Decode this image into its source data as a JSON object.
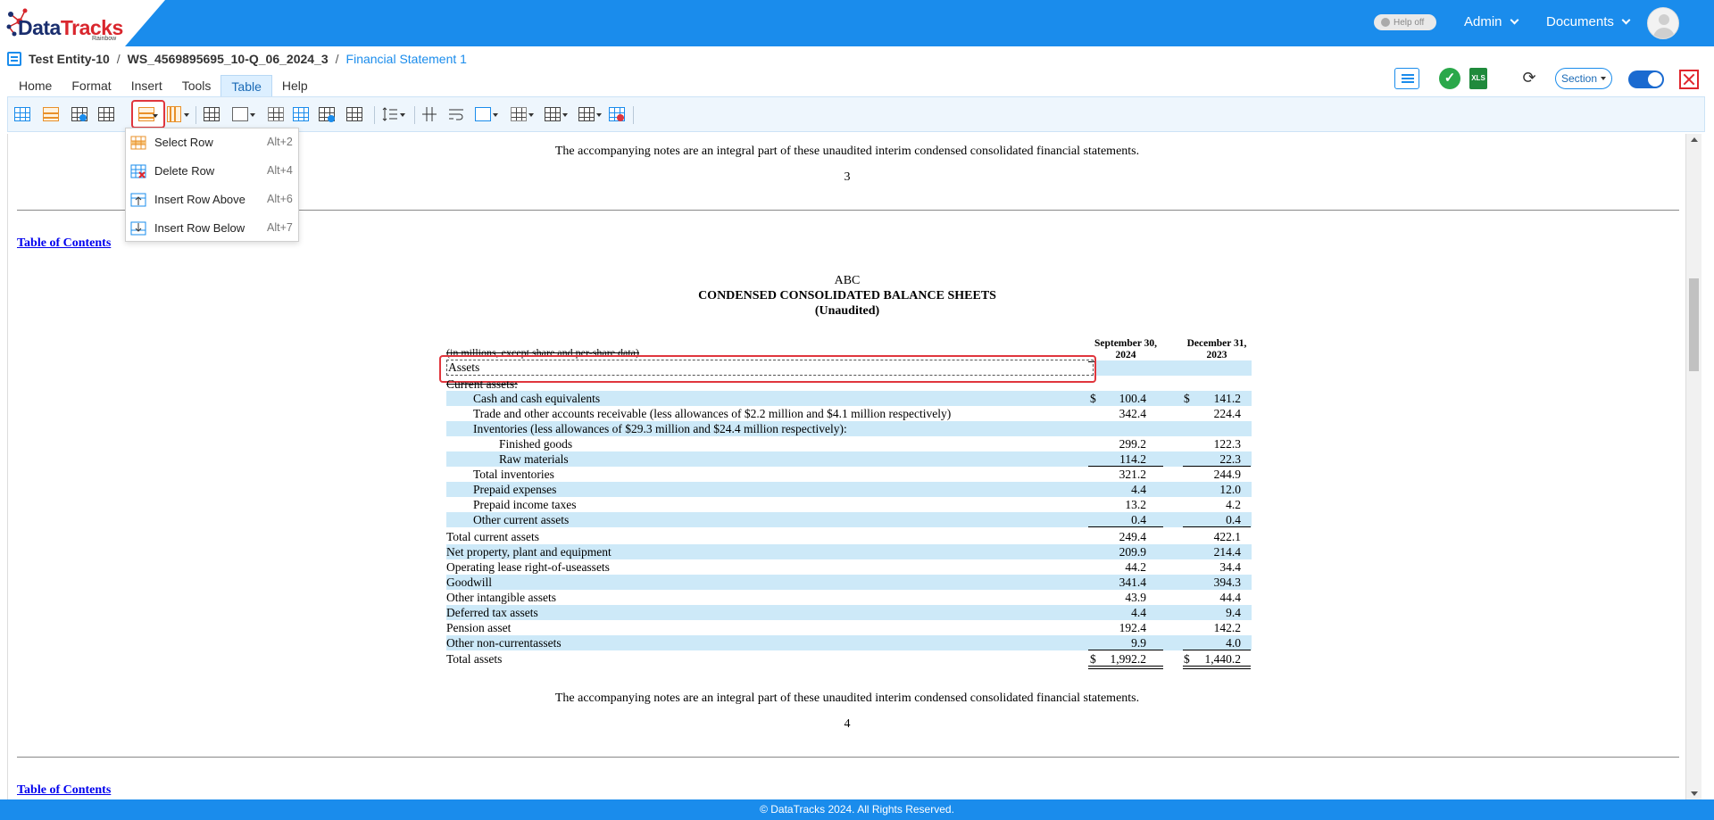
{
  "brand": {
    "logo_main": "Data",
    "logo_accent": "Tracks",
    "logo_sub": "Rainbow"
  },
  "topbar": {
    "help_toggle": "Help off",
    "admin_menu": "Admin",
    "documents_menu": "Documents"
  },
  "breadcrumb": {
    "entity": "Test Entity-10",
    "separator1": "/",
    "workspace": "WS_4569895695_10-Q_06_2024_3",
    "separator2": "/",
    "statement": "Financial Statement 1"
  },
  "tabs": [
    {
      "label": "Home"
    },
    {
      "label": "Format"
    },
    {
      "label": "Insert"
    },
    {
      "label": "Tools"
    },
    {
      "label": "Table",
      "active": true
    },
    {
      "label": "Help"
    }
  ],
  "right_tools": {
    "section_label": "Section",
    "xls_label": "XLS"
  },
  "row_menu": {
    "items": [
      {
        "label": "Select Row",
        "shortcut": "Alt+2"
      },
      {
        "label": "Delete Row",
        "shortcut": "Alt+4"
      },
      {
        "label": "Insert Row Above",
        "shortcut": "Alt+6"
      },
      {
        "label": "Insert Row Below",
        "shortcut": "Alt+7"
      }
    ]
  },
  "document": {
    "note_top": "The accompanying notes are an integral part of these unaudited interim condensed consolidated financial statements.",
    "page_num_top": "3",
    "toc_link": "Table of Contents",
    "company": "ABC",
    "statement_title": "CONDENSED CONSOLIDATED BALANCE SHEETS",
    "statement_subtitle": "(Unaudited)",
    "units_note": "(in millions, except share and per-share data)",
    "col1_header_l1": "September 30,",
    "col1_header_l2": "2024",
    "col2_header_l1": "December 31,",
    "col2_header_l2": "2023",
    "assets_label": "Assets",
    "current_assets_label": "Current assets:",
    "currency_symbol": "$",
    "rows": [
      {
        "label": "Cash and cash equivalents",
        "v1": "100.4",
        "v2": "141.2"
      },
      {
        "label": "Trade and other accounts receivable (less allowances of $2.2 million and $4.1 million respectively)",
        "v1": "342.4",
        "v2": "224.4"
      },
      {
        "label": "Inventories (less allowances of $29.3 million and $24.4 million respectively):",
        "v1": "",
        "v2": ""
      },
      {
        "label": "Finished goods",
        "v1": "299.2",
        "v2": "122.3"
      },
      {
        "label": "Raw materials",
        "v1": "114.2",
        "v2": "22.3"
      },
      {
        "label": "Total inventories",
        "v1": "321.2",
        "v2": "244.9"
      },
      {
        "label": "Prepaid expenses",
        "v1": "4.4",
        "v2": "12.0"
      },
      {
        "label": "Prepaid income taxes",
        "v1": "13.2",
        "v2": "4.2"
      },
      {
        "label": "Other current assets",
        "v1": "0.4",
        "v2": "0.4"
      },
      {
        "label": "Total current assets",
        "v1": "249.4",
        "v2": "422.1"
      },
      {
        "label": "Net property, plant and equipment",
        "v1": "209.9",
        "v2": "214.4"
      },
      {
        "label": "Operating lease right-of-useassets",
        "v1": "44.2",
        "v2": "34.4"
      },
      {
        "label": "Goodwill",
        "v1": "341.4",
        "v2": "394.3"
      },
      {
        "label": "Other intangible assets",
        "v1": "43.9",
        "v2": "44.4"
      },
      {
        "label": "Deferred tax assets",
        "v1": "4.4",
        "v2": "9.4"
      },
      {
        "label": "Pension asset",
        "v1": "192.4",
        "v2": "142.2"
      },
      {
        "label": "Other non-currentassets",
        "v1": "9.9",
        "v2": "4.0"
      },
      {
        "label": "Total assets",
        "v1": "1,992.2",
        "v2": "1,440.2"
      }
    ],
    "note_bottom": "The accompanying notes are an integral part of these unaudited interim condensed consolidated financial statements.",
    "page_num_bottom": "4",
    "toc_link_bottom": "Table of Contents"
  },
  "footer": {
    "copyright": "© DataTracks 2024. All Rights Reserved."
  }
}
